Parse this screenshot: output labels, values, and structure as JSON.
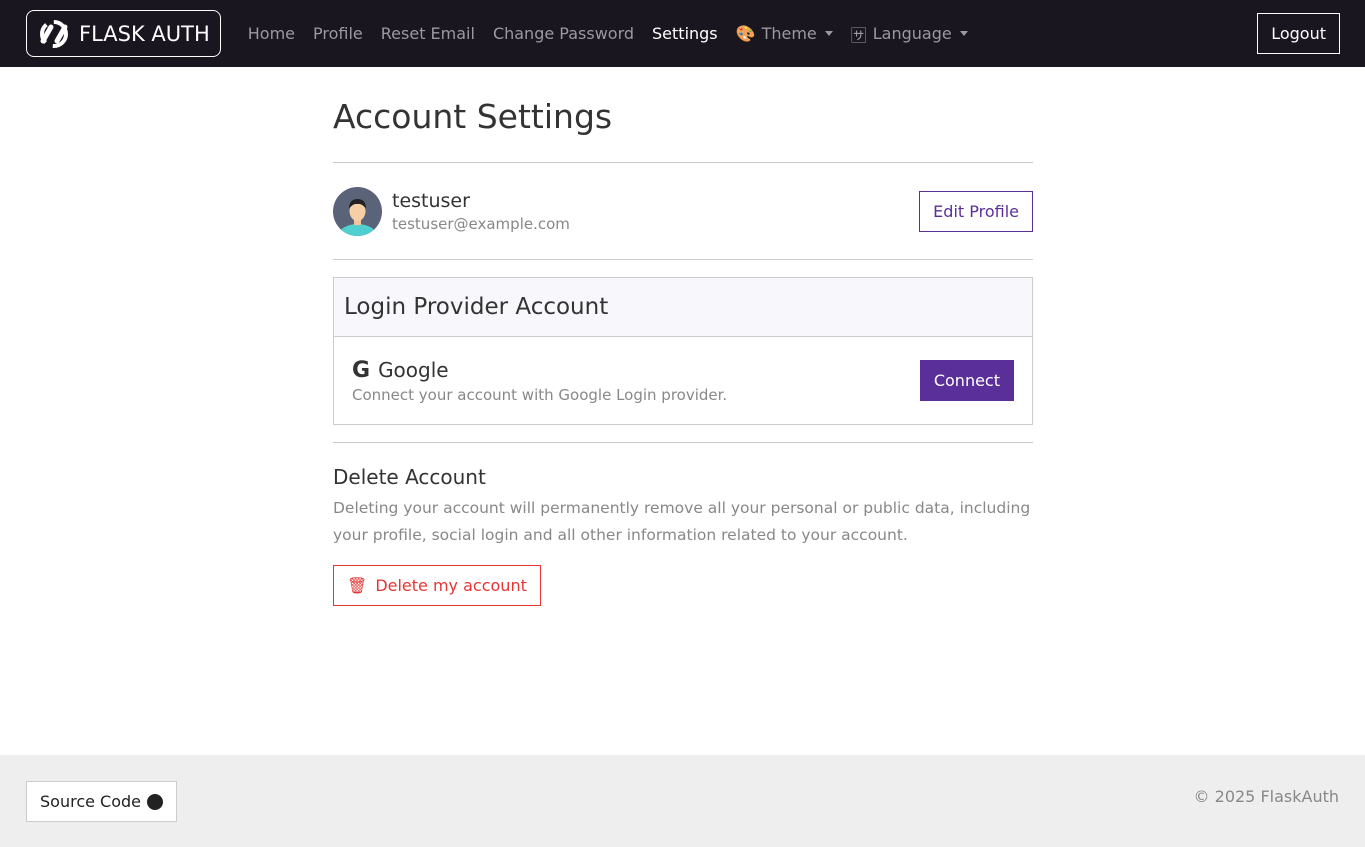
{
  "nav": {
    "brand": "FLASK AUTH",
    "links": [
      "Home",
      "Profile",
      "Reset Email",
      "Change Password",
      "Settings"
    ],
    "theme": "Theme",
    "language": "Language",
    "logout": "Logout"
  },
  "page": {
    "title": "Account Settings"
  },
  "user": {
    "name": "testuser",
    "email": "testuser@example.com",
    "edit": "Edit Profile"
  },
  "provider": {
    "header": "Login Provider Account",
    "name": "Google",
    "desc": "Connect your account with Google Login provider.",
    "connect": "Connect"
  },
  "delete": {
    "title": "Delete Account",
    "desc": "Deleting your account will permanently remove all your personal or public data, including your profile, social login and all other information related to your account.",
    "button": "Delete my account"
  },
  "footer": {
    "source": "Source Code",
    "copyright": "© 2025 FlaskAuth"
  },
  "colors": {
    "accent": "#5b2f9a",
    "danger": "#e53535",
    "nav": "#19161f"
  }
}
